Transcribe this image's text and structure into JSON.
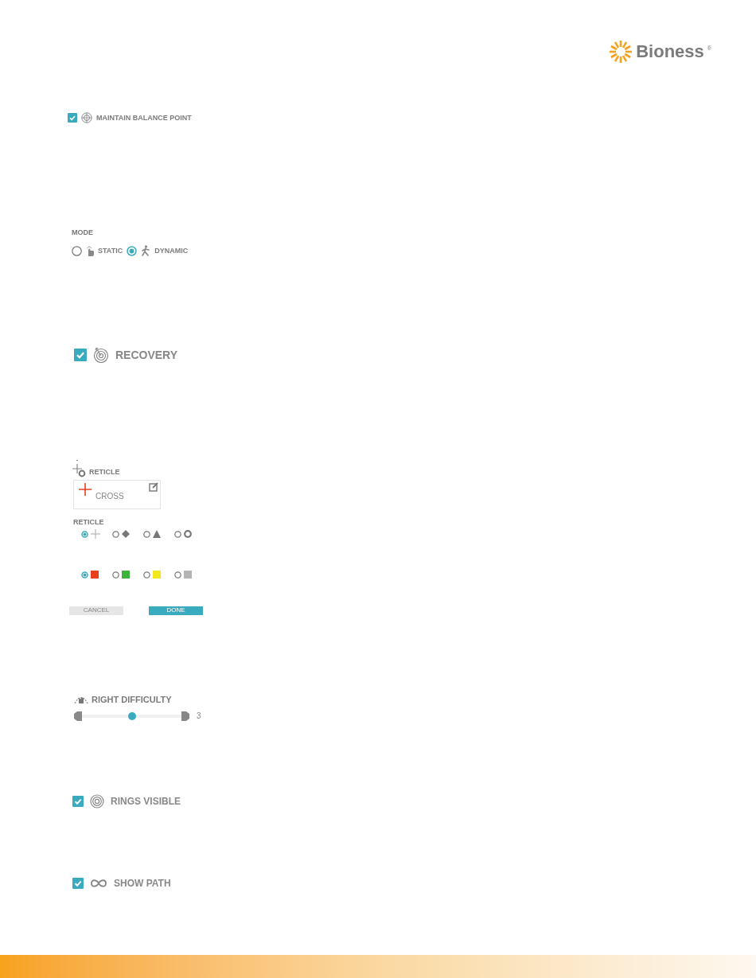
{
  "logo": {
    "text": "Bioness",
    "mark": "®"
  },
  "maintain_balance_point": {
    "label": "MAINTAIN BALANCE POINT",
    "checked": true
  },
  "mode": {
    "label": "MODE",
    "options": [
      {
        "kind": "static",
        "label": "STATIC",
        "selected": false
      },
      {
        "kind": "dynamic",
        "label": "DYNAMIC",
        "selected": true
      }
    ]
  },
  "recovery": {
    "label": "RECOVERY",
    "checked": true
  },
  "reticle_card": {
    "heading": "RETICLE",
    "value": "CROSS"
  },
  "reticle_picker": {
    "label": "RETICLE",
    "shapes": [
      {
        "kind": "cross",
        "selected": true
      },
      {
        "kind": "diamond",
        "selected": false
      },
      {
        "kind": "triangle",
        "selected": false
      },
      {
        "kind": "ring",
        "selected": false
      }
    ],
    "colors": [
      {
        "color": "#e8401c",
        "selected": true
      },
      {
        "color": "#3cb43c",
        "selected": false
      },
      {
        "color": "#f2e61c",
        "selected": false
      },
      {
        "color": "#b4b4b4",
        "selected": false
      }
    ]
  },
  "buttons": [
    {
      "kind": "secondary",
      "label": "CANCEL"
    },
    {
      "kind": "primary",
      "label": "DONE"
    }
  ],
  "right_difficulty": {
    "label": "RIGHT DIFFICULTY",
    "level": 0.5,
    "reading": "3"
  },
  "rings_visible": {
    "label": "RINGS VISIBLE",
    "checked": true
  },
  "show_path": {
    "label": "SHOW PATH",
    "checked": true
  }
}
